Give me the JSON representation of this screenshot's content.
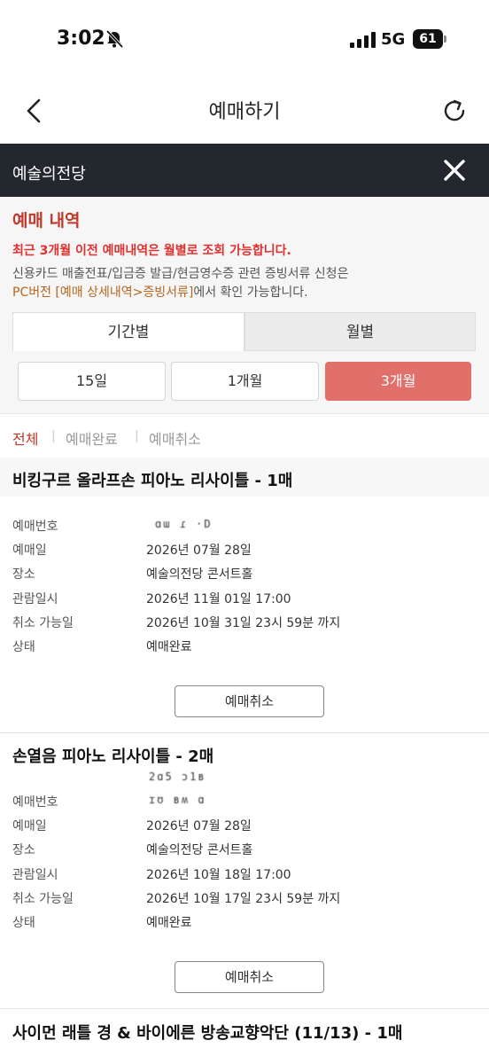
{
  "status_bar": {
    "time": "3:02",
    "network": "5G",
    "battery": "61"
  },
  "nav": {
    "title": "예매하기"
  },
  "venue_bar": {
    "title": "예술의전당"
  },
  "info": {
    "heading": "예매 내역",
    "warning": "최근 3개월 이전 예매내역은 월별로 조회 가능합니다.",
    "line1": "신용카드 매출전표/입금증 발급/현금영수증 관련 증빙서류 신청은",
    "line2_link": "PC버전 [예매 상세내역>증빙서류]",
    "line2_rest": "에서 확인 가능합니다."
  },
  "period_tabs": [
    "기간별",
    "월별"
  ],
  "ranges": [
    "15일",
    "1개월",
    "3개월"
  ],
  "filters": [
    "전체",
    "예매완료",
    "예매취소"
  ],
  "labels": {
    "booking_no": "예매번호",
    "booking_date": "예매일",
    "place": "장소",
    "show_datetime": "관람일시",
    "cancel_until": "취소 가능일",
    "status": "상태",
    "cancel_button": "예매취소"
  },
  "bookings": [
    {
      "title": "비킹구르 올라프손 피아노 리사이틀 - 1매",
      "booking_no": "ɑɯ   ɾ ·D",
      "booking_date": "2026년 07월 28일",
      "place": "예술의전당 콘서트홀",
      "show_datetime": "2026년 11월 01일 17:00",
      "cancel_until": "2026년 10월 31일 23시 59분 까지",
      "status": "예매완료"
    },
    {
      "title": "손열음 피아노 리사이틀 - 2매",
      "booking_no_top": "2ɑ5  ɔ1ʙ",
      "booking_no": "ɪʊ    ʙʍ ɑ",
      "booking_date": "2026년 07월 28일",
      "place": "예술의전당 콘서트홀",
      "show_datetime": "2026년 10월 18일 17:00",
      "cancel_until": "2026년 10월 17일 23시 59분 까지",
      "status": "예매완료"
    },
    {
      "title": "사이먼 래틀 경 & 바이에른 방송교향악단 (11/13) - 1매"
    }
  ]
}
